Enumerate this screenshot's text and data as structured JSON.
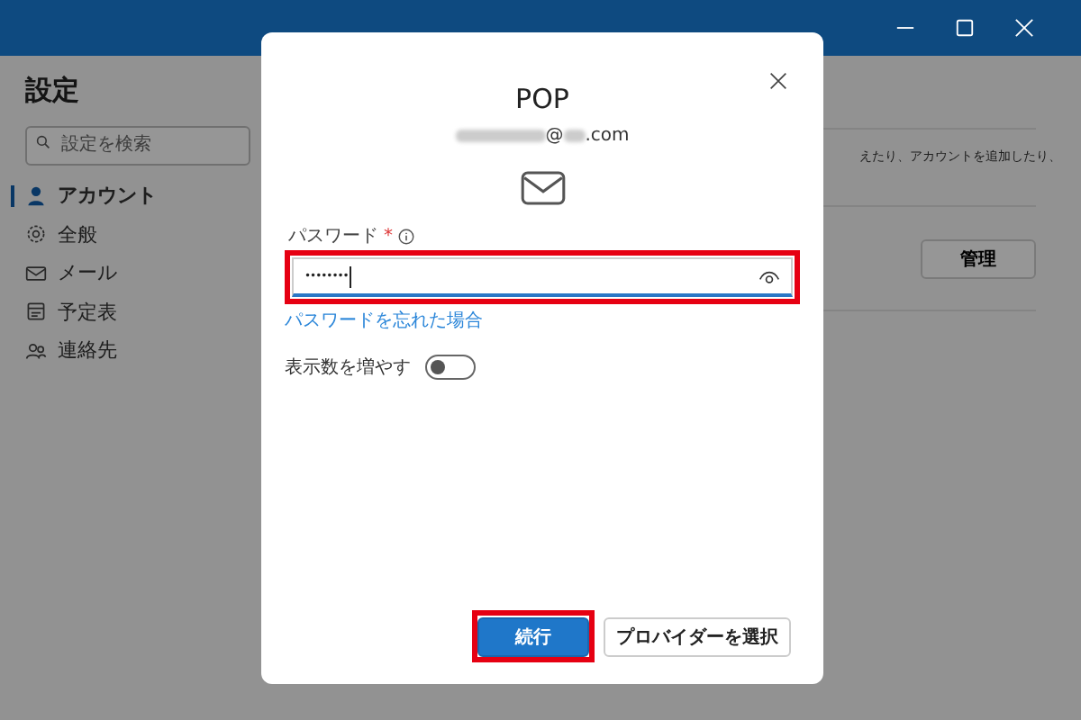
{
  "sidebar": {
    "title": "設定",
    "search": {
      "placeholder": "設定を検索"
    },
    "items": [
      {
        "label": "アカウント",
        "selected": true
      },
      {
        "label": "全般",
        "selected": false
      },
      {
        "label": "メール",
        "selected": false
      },
      {
        "label": "予定表",
        "selected": false
      },
      {
        "label": "連絡先",
        "selected": false
      }
    ]
  },
  "main": {
    "description": "えたり、アカウントを追加したり、",
    "manage_button": "管理"
  },
  "dialog": {
    "title": "POP",
    "email": {
      "at": "@",
      "suffix": ".com"
    },
    "password": {
      "label": "パスワード",
      "required_mark": "*",
      "value": "••••••••",
      "highlighted": true
    },
    "forgot_link": "パスワードを忘れた場合",
    "toggle": {
      "label": "表示数を増やす",
      "on": false
    },
    "buttons": [
      {
        "label": "続行",
        "kind": "primary",
        "highlighted": true
      },
      {
        "label": "プロバイダーを選択",
        "kind": "secondary",
        "highlighted": false
      }
    ]
  }
}
